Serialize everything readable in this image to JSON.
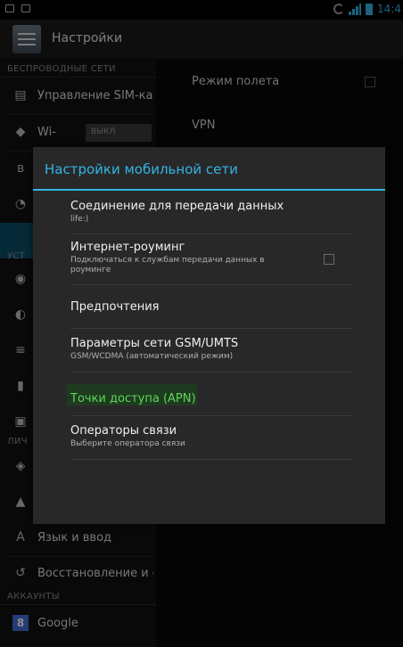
{
  "statusbar": {
    "time": "14:4"
  },
  "actionbar": {
    "title": "Настройки"
  },
  "sidebar": {
    "wireless_section": "БЕСПРОВОДНЫЕ СЕТИ",
    "sim_label": "Управление SIM-кар",
    "wifi_label": "Wi-",
    "wifi_toggle": "ВЫКЛ",
    "device_section": "УСТ",
    "personal_section": "ЛИЧ",
    "language_label": "Язык и ввод",
    "backup_label": "Восстановление и с",
    "accounts_section": "АККАУНТЫ",
    "google_label": "Google"
  },
  "right_pane": {
    "airplane_label": "Режим полета",
    "vpn_label": "VPN"
  },
  "dialog": {
    "title": "Настройки мобильной сети",
    "options": [
      {
        "title": "Соединение для передачи данных",
        "summary": "life:)"
      },
      {
        "title": "Интернет-роуминг",
        "summary": "Подключаться к службам передачи данных в роуминге"
      },
      {
        "title": "Предпочтения",
        "summary": ""
      },
      {
        "title": "Параметры сети GSM/UMTS",
        "summary": "GSM/WCDMA (автоматический режим)"
      },
      {
        "title": "Точки доступа (APN)",
        "summary": ""
      },
      {
        "title": "Операторы связи",
        "summary": "Выберите оператора связи"
      }
    ]
  },
  "colors": {
    "accent": "#33b5e5",
    "apn_highlight": "#5cd65c"
  }
}
